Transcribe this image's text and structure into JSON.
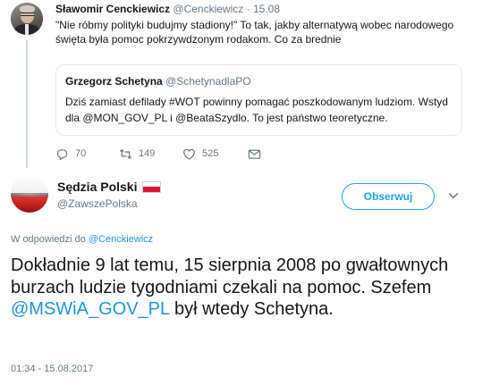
{
  "parent_tweet": {
    "author_name": "Sławomir Cenckiewicz",
    "author_handle": "@Cenckiewicz",
    "separator": "·",
    "date": "15.08",
    "text": "\"Nie róbmy polityki budujmy stadiony!\" To tak, jakby alternatywą wobec narodowego święta była pomoc pokrzywdzonym rodakom. Co za brednie",
    "quoted": {
      "author_name": "Grzegorz Schetyna",
      "author_handle": "@SchetynadlaPO",
      "text": "Dziś zamiast defilady #WOT powinny pomagać poszkodowanym ludziom. Wstyd dla @MON_GOV_PL i @BeataSzydlo. To jest państwo teoretyczne."
    },
    "actions": {
      "reply_count": "70",
      "retweet_count": "149",
      "like_count": "525"
    }
  },
  "main_tweet": {
    "author_name": "Sędzia Polski",
    "author_handle": "@ZawszePolska",
    "follow_label": "Obserwuj",
    "reply_prefix": "W odpowiedzi do",
    "reply_handle": "@Cenckiewicz",
    "text_before_mention": "Dokładnie 9 lat temu, 15 sierpnia 2008 po gwałtownych burzach ludzie tygodniami czekali na pomoc. Szefem ",
    "mention": "@MSWiA_GOV_PL",
    "text_after_mention": " był wtedy Schetyna.",
    "timestamp": "01:34 - 15.08.2017"
  },
  "colors": {
    "accent": "#1da1f2",
    "link": "#1b95e0",
    "muted": "#657786",
    "text": "#14171a",
    "border": "#e1e8ed"
  },
  "icons": [
    "reply-icon",
    "retweet-icon",
    "like-icon",
    "direct-message-icon",
    "chevron-down-icon",
    "poland-flag-icon"
  ]
}
